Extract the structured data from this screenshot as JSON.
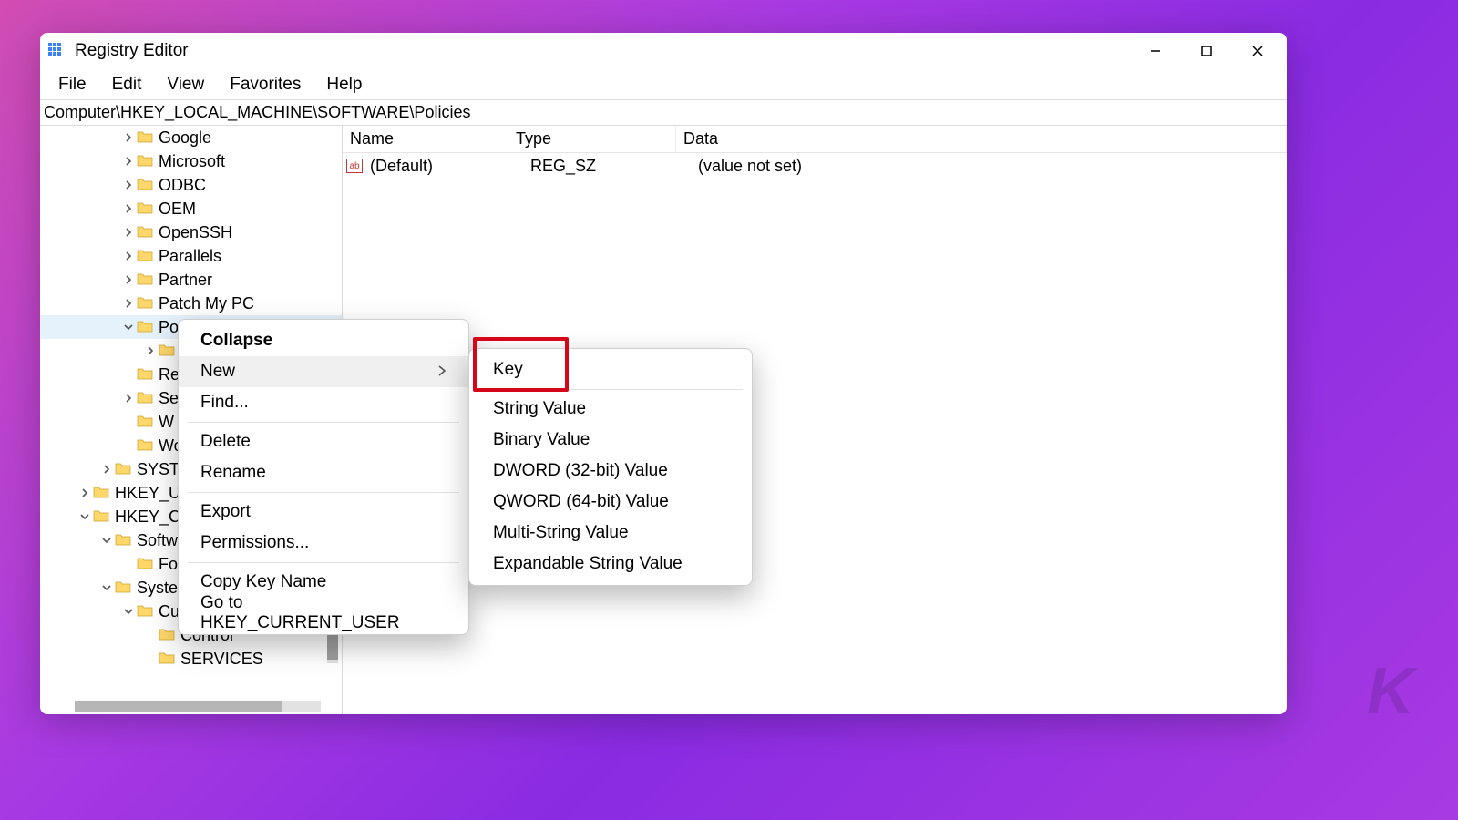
{
  "window": {
    "title": "Registry Editor"
  },
  "menu": {
    "file": "File",
    "edit": "Edit",
    "view": "View",
    "favorites": "Favorites",
    "help": "Help"
  },
  "address": "Computer\\HKEY_LOCAL_MACHINE\\SOFTWARE\\Policies",
  "tree": [
    {
      "indent": 3,
      "twisty": ">",
      "label": "Google"
    },
    {
      "indent": 3,
      "twisty": ">",
      "label": "Microsoft"
    },
    {
      "indent": 3,
      "twisty": ">",
      "label": "ODBC"
    },
    {
      "indent": 3,
      "twisty": ">",
      "label": "OEM"
    },
    {
      "indent": 3,
      "twisty": ">",
      "label": "OpenSSH"
    },
    {
      "indent": 3,
      "twisty": ">",
      "label": "Parallels"
    },
    {
      "indent": 3,
      "twisty": ">",
      "label": "Partner"
    },
    {
      "indent": 3,
      "twisty": ">",
      "label": "Patch My PC"
    },
    {
      "indent": 3,
      "twisty": "v",
      "label": "Po",
      "selected": true
    },
    {
      "indent": 4,
      "twisty": ">",
      "label": ""
    },
    {
      "indent": 3,
      "twisty": "",
      "label": "Re"
    },
    {
      "indent": 3,
      "twisty": ">",
      "label": "Se"
    },
    {
      "indent": 3,
      "twisty": "",
      "label": "W"
    },
    {
      "indent": 3,
      "twisty": "",
      "label": "Wo"
    },
    {
      "indent": 2,
      "twisty": ">",
      "label": "SYSTE"
    },
    {
      "indent": 1,
      "twisty": ">",
      "label": "HKEY_US"
    },
    {
      "indent": 1,
      "twisty": "v",
      "label": "HKEY_CU"
    },
    {
      "indent": 2,
      "twisty": "v",
      "label": "Softw"
    },
    {
      "indent": 3,
      "twisty": "",
      "label": "Fo"
    },
    {
      "indent": 2,
      "twisty": "v",
      "label": "Syste"
    },
    {
      "indent": 3,
      "twisty": "v",
      "label": "Cu"
    },
    {
      "indent": 4,
      "twisty": "",
      "label": "Control"
    },
    {
      "indent": 4,
      "twisty": "",
      "label": "SERVICES"
    }
  ],
  "columns": {
    "name": "Name",
    "type": "Type",
    "data": "Data"
  },
  "values": [
    {
      "name": "(Default)",
      "type": "REG_SZ",
      "data": "(value not set)"
    }
  ],
  "context_menu": {
    "collapse": "Collapse",
    "new": "New",
    "find": "Find...",
    "delete": "Delete",
    "rename": "Rename",
    "export": "Export",
    "permissions": "Permissions...",
    "copy_key_name": "Copy Key Name",
    "go_to": "Go to HKEY_CURRENT_USER"
  },
  "submenu_new": {
    "key": "Key",
    "string": "String Value",
    "binary": "Binary Value",
    "dword": "DWORD (32-bit) Value",
    "qword": "QWORD (64-bit) Value",
    "multi": "Multi-String Value",
    "expand": "Expandable String Value"
  },
  "icons": {
    "ab": "ab"
  },
  "watermark": "K"
}
